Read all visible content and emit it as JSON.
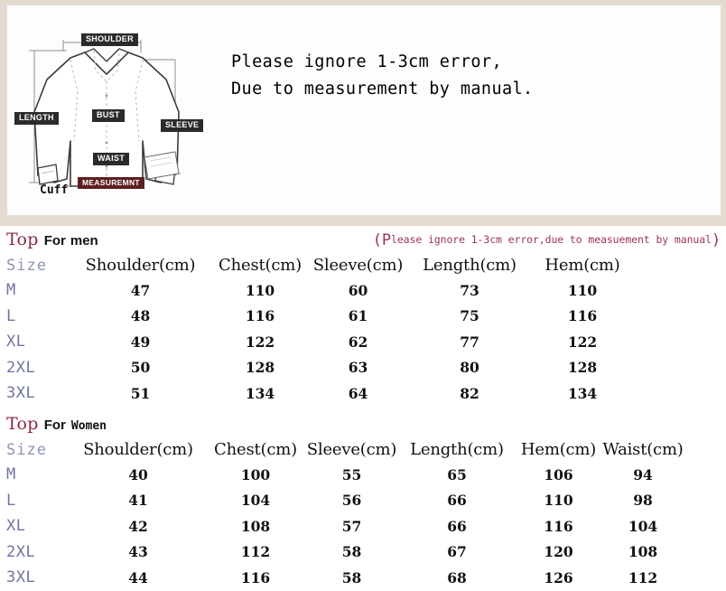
{
  "diagram": {
    "labels": {
      "shoulder": "SHOULDER",
      "length": "LENGTH",
      "sleeve": "SLEEVE",
      "bust": "BUST",
      "waist": "WAIST",
      "measurement": "MEASUREMNT",
      "cuff": "Cuff"
    },
    "note_line1": "Please ignore 1-3cm error,",
    "note_line2": "Due to measurement by manual."
  },
  "colors": {
    "panel_border": "#e4dbd0",
    "title_maroon": "#8d2a3f",
    "note_maroon": "#9c3552",
    "size_blue": "#6f74a3",
    "label_dark": "#2b2b2b",
    "measurement_maroon": "#5e1f20"
  },
  "men": {
    "title_top": "Top",
    "title_for": "For",
    "title_who": "men",
    "note_open": "(",
    "note_p": "P",
    "note_rest": "lease ignore 1-3cm error,due to measuement by manual",
    "note_close": ")",
    "columns": [
      "Size",
      "Shoulder(cm)",
      "Chest(cm)",
      "Sleeve(cm)",
      "Length(cm)",
      "Hem(cm)"
    ],
    "rows": [
      {
        "size": "M",
        "shoulder": "47",
        "chest": "110",
        "sleeve": "60",
        "length": "73",
        "hem": "110"
      },
      {
        "size": "L",
        "shoulder": "48",
        "chest": "116",
        "sleeve": "61",
        "length": "75",
        "hem": "116"
      },
      {
        "size": "XL",
        "shoulder": "49",
        "chest": "122",
        "sleeve": "62",
        "length": "77",
        "hem": "122"
      },
      {
        "size": "2XL",
        "shoulder": "50",
        "chest": "128",
        "sleeve": "63",
        "length": "80",
        "hem": "128"
      },
      {
        "size": "3XL",
        "shoulder": "51",
        "chest": "134",
        "sleeve": "64",
        "length": "82",
        "hem": "134"
      }
    ]
  },
  "women": {
    "title_top": "Top",
    "title_for": "For",
    "title_who": "Women",
    "columns": [
      "Size",
      "Shoulder(cm)",
      "Chest(cm)",
      "Sleeve(cm)",
      "Length(cm)",
      "Hem(cm)",
      "Waist(cm)"
    ],
    "rows": [
      {
        "size": "M",
        "shoulder": "40",
        "chest": "100",
        "sleeve": "55",
        "length": "65",
        "hem": "106",
        "waist": "94"
      },
      {
        "size": "L",
        "shoulder": "41",
        "chest": "104",
        "sleeve": "56",
        "length": "66",
        "hem": "110",
        "waist": "98"
      },
      {
        "size": "XL",
        "shoulder": "42",
        "chest": "108",
        "sleeve": "57",
        "length": "66",
        "hem": "116",
        "waist": "104"
      },
      {
        "size": "2XL",
        "shoulder": "43",
        "chest": "112",
        "sleeve": "58",
        "length": "67",
        "hem": "120",
        "waist": "108"
      },
      {
        "size": "3XL",
        "shoulder": "44",
        "chest": "116",
        "sleeve": "58",
        "length": "68",
        "hem": "126",
        "waist": "112"
      }
    ]
  }
}
